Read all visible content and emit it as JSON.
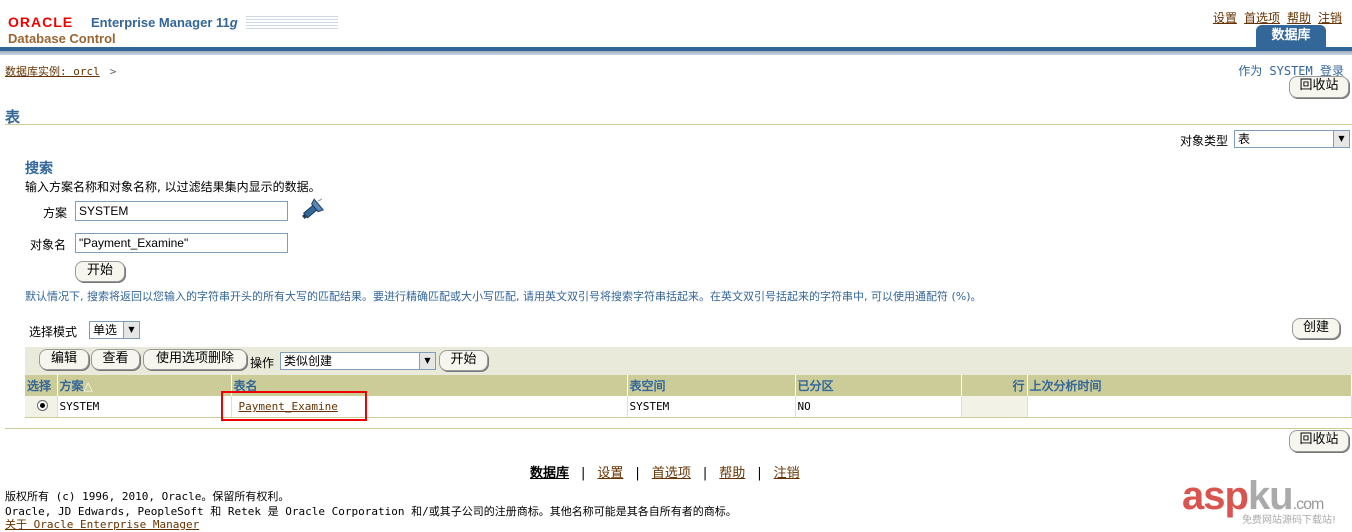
{
  "header": {
    "logo_oracle": "ORACLE",
    "logo_em": "Enterprise Manager 11",
    "logo_em_g": "g",
    "logo_sub": "Database Control",
    "links": [
      "设置",
      "首选项",
      "帮助",
      "注销"
    ],
    "tab": "数据库"
  },
  "breadcrumb": {
    "text": "数据库实例: orcl",
    "sep": ">"
  },
  "login_as": "作为 SYSTEM 登录",
  "recycle_bin_label": "回收站",
  "page_title": "表",
  "object_type": {
    "label": "对象类型",
    "value": "表"
  },
  "search": {
    "title": "搜索",
    "description": "输入方案名称和对象名称, 以过滤结果集内显示的数据。",
    "schema_label": "方案",
    "schema_value": "SYSTEM",
    "object_label": "对象名",
    "object_value": "\"Payment_Examine\"",
    "go_label": "开始",
    "hint": "默认情况下, 搜索将返回以您输入的字符串开头的所有大写的匹配结果。要进行精确匹配或大小写匹配, 请用英文双引号将搜索字符串括起来。在英文双引号括起来的字符串中, 可以使用通配符 (%)。"
  },
  "selection_mode": {
    "label": "选择模式",
    "value": "单选"
  },
  "create_label": "创建",
  "toolbar": {
    "edit": "编辑",
    "view": "查看",
    "delete": "使用选项删除",
    "action_label": "操作",
    "action_value": "类似创建",
    "go": "开始"
  },
  "table": {
    "headers": [
      "选择",
      "方案",
      "表名",
      "表空间",
      "已分区",
      "行",
      "上次分析时间"
    ],
    "sort_indicator": "△",
    "rows": [
      {
        "schema": "SYSTEM",
        "name": "Payment_Examine",
        "tablespace": "SYSTEM",
        "partitioned": "NO",
        "rows": "",
        "last_analyzed": ""
      }
    ]
  },
  "footer": {
    "links": [
      "数据库",
      "设置",
      "首选项",
      "帮助",
      "注销"
    ],
    "sep": "|",
    "copyright1": "版权所有 (c) 1996, 2010, Oracle。保留所有权利。",
    "copyright2": "Oracle, JD Edwards, PeopleSoft 和 Retek 是 Oracle Corporation 和/或其子公司的注册商标。其他名称可能是其各自所有者的商标。",
    "about": "关于 Oracle Enterprise Manager"
  },
  "watermark": {
    "asp": "asp",
    "ku": "ku",
    "com": ".com",
    "sub": "免费网站源码下载站!"
  },
  "colors": {
    "brand_blue": "#336699",
    "link_brown": "#663300",
    "header_tan": "#cccc99",
    "highlight_red": "#e00000"
  }
}
